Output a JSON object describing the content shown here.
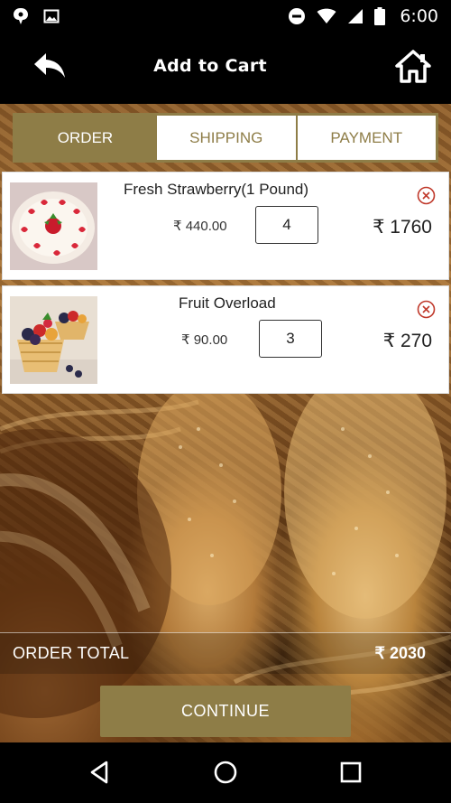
{
  "status_bar": {
    "time": "6:00",
    "icons": [
      "notification-icon",
      "image-icon",
      "do-not-disturb-icon",
      "wifi-icon",
      "signal-icon",
      "battery-icon"
    ]
  },
  "toolbar": {
    "title": "Add to Cart",
    "back_icon": "back-arrow-icon",
    "home_icon": "home-icon"
  },
  "tabs": [
    {
      "label": "ORDER",
      "active": true
    },
    {
      "label": "SHIPPING",
      "active": false
    },
    {
      "label": "PAYMENT",
      "active": false
    }
  ],
  "cart": {
    "items": [
      {
        "name": "Fresh Strawberry(1 Pound)",
        "unit_price": "₹ 440.00",
        "quantity": "4",
        "line_total": "₹ 1760",
        "image": "strawberry-cake-image"
      },
      {
        "name": "Fruit Overload",
        "unit_price": "₹ 90.00",
        "quantity": "3",
        "line_total": "₹ 270",
        "image": "fruit-tart-image"
      }
    ]
  },
  "order_total": {
    "label": "ORDER TOTAL",
    "value": "₹ 2030"
  },
  "continue_label": "CONTINUE",
  "colors": {
    "accent": "#8e7d47",
    "toolbar": "#000000",
    "card": "#ffffff",
    "remove": "#c0392b"
  },
  "nav": [
    "back-triangle-icon",
    "home-circle-icon",
    "recents-square-icon"
  ]
}
